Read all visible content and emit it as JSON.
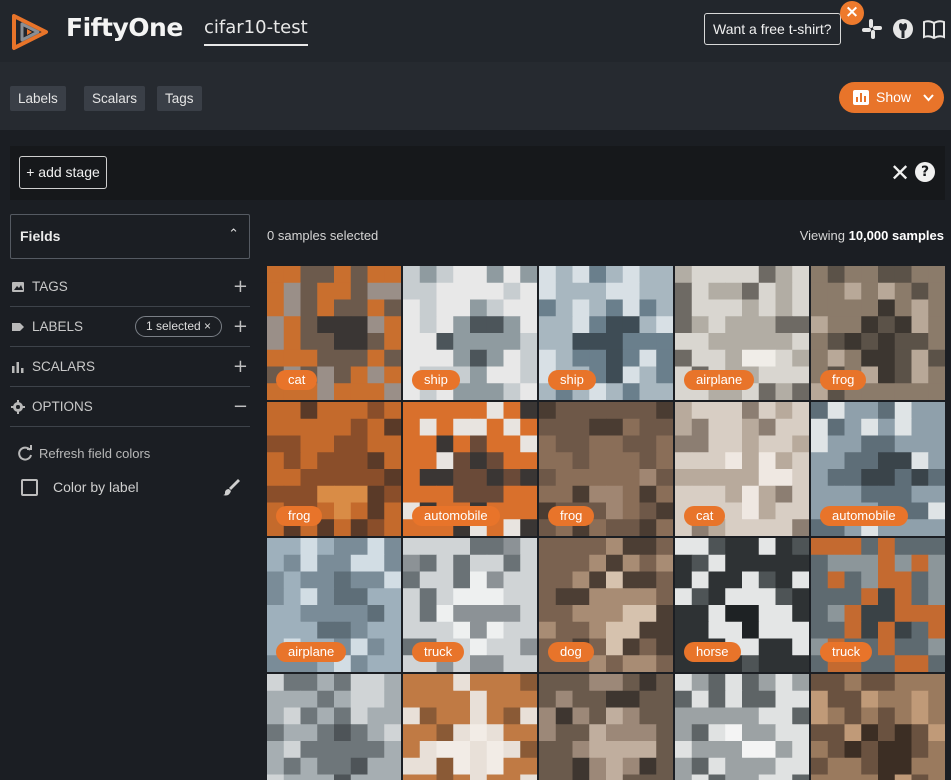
{
  "header": {
    "brand": "FiftyOne",
    "dataset": "cifar10-test",
    "tshirt_label": "Want a free t-shirt?",
    "close_glyph": "×",
    "icons": [
      "slack-icon",
      "github-icon",
      "docs-book-icon"
    ]
  },
  "tabs": [
    "Labels",
    "Scalars",
    "Tags"
  ],
  "show_button": "Show",
  "stage": {
    "add_label": "+ add stage",
    "clear_glyph": "✕",
    "help_glyph": "?"
  },
  "sidebar": {
    "fields_title": "Fields",
    "groups": [
      {
        "label": "TAGS",
        "icon": "image-tag-icon",
        "action": "+"
      },
      {
        "label": "LABELS",
        "icon": "label-tag-icon",
        "action": "+",
        "pill": "1 selected ×"
      },
      {
        "label": "SCALARS",
        "icon": "bar-chart-icon",
        "action": "+"
      },
      {
        "label": "OPTIONS",
        "icon": "gear-icon",
        "action": "−"
      }
    ],
    "refresh_label": "Refresh field colors",
    "color_by_label": "Color by label",
    "color_by_checked": false
  },
  "main": {
    "selected_text": "0 samples selected",
    "viewing_prefix": "Viewing ",
    "viewing_count": "10,000 samples"
  },
  "tiles": [
    {
      "label": "cat",
      "colors": [
        "#c96f2e",
        "#6c5a4c",
        "#9a8f88",
        "#3a3634"
      ]
    },
    {
      "label": "ship",
      "colors": [
        "#e8e8e8",
        "#8f9ba0",
        "#c7cdd0",
        "#4c555a"
      ]
    },
    {
      "label": "ship",
      "colors": [
        "#a8b7c0",
        "#6a7f8c",
        "#d8e0e5",
        "#3e4c55"
      ]
    },
    {
      "label": "airplane",
      "colors": [
        "#d9d6d0",
        "#b2ada4",
        "#6e6a64",
        "#f0ede8"
      ]
    },
    {
      "label": "frog",
      "colors": [
        "#8b7b6a",
        "#5b5248",
        "#b8a898",
        "#3c3630"
      ]
    },
    {
      "label": "frog",
      "colors": [
        "#c46a2c",
        "#8a4e2a",
        "#5a3a28",
        "#d98c46"
      ]
    },
    {
      "label": "automobile",
      "colors": [
        "#d9702c",
        "#3a3634",
        "#e8e4e0",
        "#6a4a38"
      ]
    },
    {
      "label": "frog",
      "colors": [
        "#6e5848",
        "#8a6e58",
        "#4a3c32",
        "#a08672"
      ]
    },
    {
      "label": "cat",
      "colors": [
        "#d8cec4",
        "#b8aa9c",
        "#8c7e72",
        "#efe8e2"
      ]
    },
    {
      "label": "automobile",
      "colors": [
        "#8fa0ab",
        "#5e6e78",
        "#dfe4e6",
        "#3a444a"
      ]
    },
    {
      "label": "airplane",
      "colors": [
        "#9eb0bc",
        "#7a8c98",
        "#d2dde4",
        "#5e6e78"
      ]
    },
    {
      "label": "truck",
      "colors": [
        "#d0d4d6",
        "#8c9296",
        "#6a7276",
        "#eef0f0"
      ]
    },
    {
      "label": "dog",
      "colors": [
        "#7a6250",
        "#a88c74",
        "#4c3e34",
        "#d6c2ae"
      ]
    },
    {
      "label": "horse",
      "colors": [
        "#2e3234",
        "#e4e6e6",
        "#4e5456",
        "#1e2224"
      ]
    },
    {
      "label": "truck",
      "colors": [
        "#5e6a70",
        "#c46a30",
        "#8c969a",
        "#3a4246"
      ]
    },
    {
      "label": "",
      "colors": [
        "#a6aeb2",
        "#6e767a",
        "#d0d4d6",
        "#4e5458"
      ]
    },
    {
      "label": "",
      "colors": [
        "#c07a44",
        "#e8e0d8",
        "#8a5a36",
        "#f2ece6"
      ]
    },
    {
      "label": "",
      "colors": [
        "#6a5a4c",
        "#9c8878",
        "#3e3630",
        "#c0ae9e"
      ]
    },
    {
      "label": "",
      "colors": [
        "#e0e2e2",
        "#9ca2a4",
        "#5e6466",
        "#f4f4f4"
      ]
    },
    {
      "label": "",
      "colors": [
        "#9a7a5e",
        "#6a5240",
        "#c09a78",
        "#3c2e24"
      ]
    }
  ],
  "colors": {
    "accent": "#e8742a",
    "background": "#1b1e23",
    "topbar": "#22262c"
  }
}
